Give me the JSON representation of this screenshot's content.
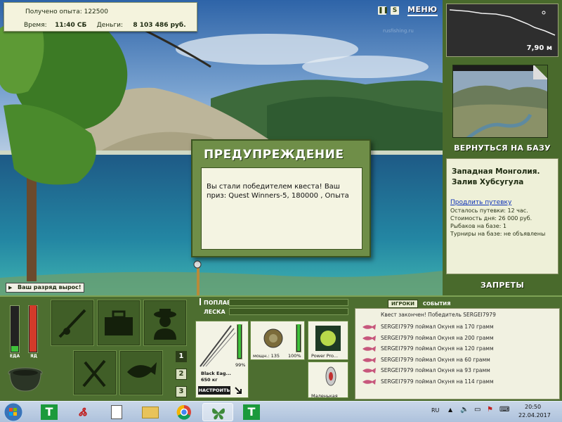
{
  "hud": {
    "experience": "Получено опыта: 122500",
    "time_label": "Время:",
    "time_value": "11:40 СБ",
    "money_label": "Деньги:",
    "money_value": "8 103 486 руб."
  },
  "topbar": {
    "pause_icon": "pause-icon",
    "s_label": "S",
    "menu_label": "МЕНЮ"
  },
  "depth": {
    "value": "7,90 м"
  },
  "sidebar": {
    "return_label": "ВЕРНУТЬСЯ НА БАЗУ",
    "location_name_1": "Западная Монголия.",
    "location_name_2": "Залив Хубсугула",
    "extend_link": "Продлить путевку",
    "days_left": "Осталось путевки: 12 час.",
    "day_cost": "Стоимость дня: 26 000 руб.",
    "fishers": "Рыбаков на базе: 1",
    "tournaments": "Турниры на базе: не объявлены",
    "bans_label": "ЗАПРЕТЫ"
  },
  "dialog": {
    "title": "ПРЕДУПРЕЖДЕНИЕ",
    "message": "Вы стали победителем квеста! Ваш приз: Quest Winners-5, 180000 , Опыта"
  },
  "toast": {
    "text": "Ваш разряд вырос!"
  },
  "meters": {
    "food_label": "ЕДА",
    "poison_label": "ЯД",
    "food_level": 0.12,
    "poison_level": 1.0
  },
  "rod_slots": [
    "1",
    "2",
    "3"
  ],
  "tackle": {
    "float_label": "ПОПЛАВОК",
    "line_label": "ЛЕСКА",
    "rod_name": "Black Eag...",
    "rod_weight": "650 кг",
    "rod_pct": "99%",
    "reel_power": "мощн.: 135",
    "reel_pct": "100%",
    "lure1": "Power Pro...",
    "lure2": "Маленькая",
    "setup_label": "НАСТРОИТЬ"
  },
  "tabs": {
    "players": "ИГРОКИ",
    "events": "СОБЫТИЯ"
  },
  "log": {
    "header": "Квест закончен! Победитель SERGEI7979",
    "entries": [
      "SERGEI7979 поймал Окуня на 170 грамм",
      "SERGEI7979 поймал Окуня на 200 грамм",
      "SERGEI7979 поймал Окуня на 120 грамм",
      "SERGEI7979 поймал Окуня на 60 грамм",
      "SERGEI7979 поймал Окуня на 93 грамм",
      "SERGEI7979 поймал Окуня на 114 грамм"
    ]
  },
  "taskbar": {
    "lang": "RU",
    "time": "20:50",
    "date": "22.04.2017",
    "t_label": "T"
  }
}
